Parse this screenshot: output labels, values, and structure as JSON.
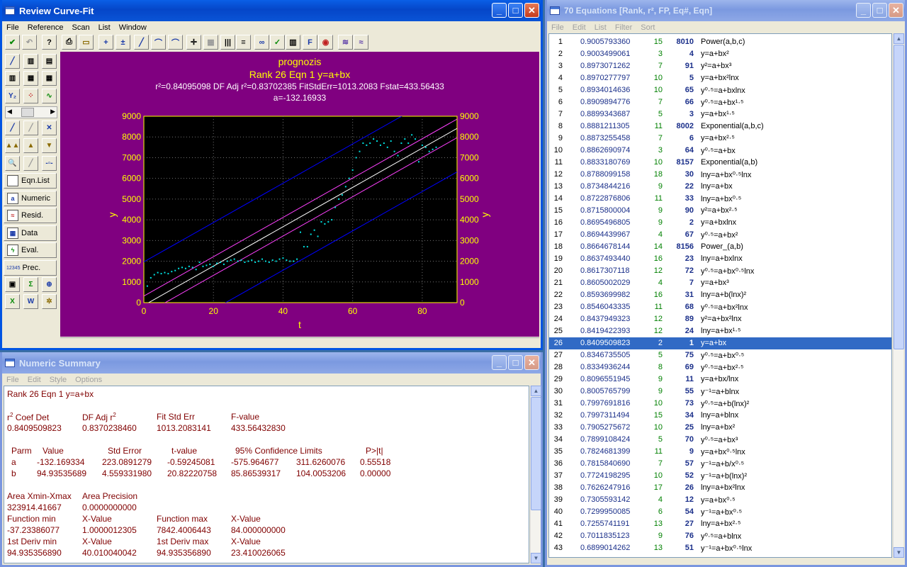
{
  "curvefit": {
    "title": "Review Curve-Fit",
    "menu": [
      "File",
      "Reference",
      "Scan",
      "List",
      "Window"
    ],
    "side_buttons": [
      "Eqn.List",
      "Numeric",
      "Resid.",
      "Data",
      "Eval.",
      "Prec."
    ],
    "prec_icon_text": "12345"
  },
  "chart_data": {
    "type": "scatter",
    "title": "prognozis",
    "subtitle": "Rank 26  Eqn 1  y=a+bx",
    "stats_line": "r²=0.84095098  DF Adj r²=0.83702385  FitStdErr=1013.2083  Fstat=433.56433",
    "param_line": "a=-132.16933",
    "xlabel": "t",
    "ylabel": "y",
    "xlim": [
      0,
      90
    ],
    "ylim": [
      0,
      9000
    ],
    "xticks": [
      "0",
      "20",
      "40",
      "60",
      "80"
    ],
    "yticks": [
      "0",
      "1000",
      "2000",
      "3000",
      "4000",
      "5000",
      "6000",
      "7000",
      "8000",
      "9000"
    ],
    "grid": true,
    "fit": {
      "a": -132.169334,
      "b": 94.93535689
    },
    "colors": {
      "background": "#800080",
      "plot": "#000000",
      "points": "#00e0e0",
      "fit": "#ffffff",
      "confidence": "#ff40ff",
      "prediction": "#0000ff",
      "text": "#ffff00"
    },
    "points": [
      [
        1,
        800
      ],
      [
        2,
        1200
      ],
      [
        3,
        1350
      ],
      [
        4,
        1450
      ],
      [
        5,
        1400
      ],
      [
        6,
        1450
      ],
      [
        7,
        1400
      ],
      [
        8,
        1500
      ],
      [
        9,
        1550
      ],
      [
        10,
        1650
      ],
      [
        11,
        1700
      ],
      [
        12,
        1650
      ],
      [
        13,
        1750
      ],
      [
        14,
        1700
      ],
      [
        15,
        1600
      ],
      [
        16,
        1950
      ],
      [
        17,
        1750
      ],
      [
        18,
        1800
      ],
      [
        19,
        1850
      ],
      [
        20,
        1750
      ],
      [
        21,
        1900
      ],
      [
        22,
        1950
      ],
      [
        23,
        1850
      ],
      [
        24,
        2000
      ],
      [
        25,
        2050
      ],
      [
        26,
        2100
      ],
      [
        27,
        2000
      ],
      [
        28,
        2050
      ],
      [
        29,
        1950
      ],
      [
        30,
        2000
      ],
      [
        31,
        2050
      ],
      [
        32,
        1950
      ],
      [
        33,
        2000
      ],
      [
        34,
        2100
      ],
      [
        35,
        2000
      ],
      [
        36,
        1950
      ],
      [
        37,
        2050
      ],
      [
        38,
        2000
      ],
      [
        39,
        2100
      ],
      [
        40,
        2150
      ],
      [
        41,
        2050
      ],
      [
        42,
        2000
      ],
      [
        43,
        2000
      ],
      [
        44,
        2100
      ],
      [
        45,
        3400
      ],
      [
        46,
        2700
      ],
      [
        47,
        2700
      ],
      [
        48,
        3300
      ],
      [
        49,
        3500
      ],
      [
        50,
        3200
      ],
      [
        51,
        3900
      ],
      [
        52,
        3800
      ],
      [
        53,
        3900
      ],
      [
        54,
        4000
      ],
      [
        55,
        4600
      ],
      [
        56,
        5000
      ],
      [
        57,
        5200
      ],
      [
        58,
        5600
      ],
      [
        59,
        6000
      ],
      [
        60,
        6400
      ],
      [
        61,
        7000
      ],
      [
        62,
        7300
      ],
      [
        63,
        7700
      ],
      [
        64,
        7600
      ],
      [
        65,
        7700
      ],
      [
        66,
        7900
      ],
      [
        67,
        7800
      ],
      [
        68,
        7600
      ],
      [
        69,
        7700
      ],
      [
        70,
        7500
      ],
      [
        71,
        7800
      ],
      [
        72,
        7300
      ],
      [
        73,
        7100
      ],
      [
        74,
        7700
      ],
      [
        75,
        7900
      ],
      [
        76,
        7700
      ],
      [
        77,
        8100
      ],
      [
        78,
        7900
      ],
      [
        79,
        6800
      ],
      [
        80,
        7600
      ],
      [
        81,
        7500
      ],
      [
        82,
        7300
      ],
      [
        83,
        7400
      ],
      [
        84,
        7500
      ]
    ]
  },
  "numeric": {
    "title": "Numeric Summary",
    "menu": [
      "File",
      "Edit",
      "Style",
      "Options"
    ],
    "header": "Rank 26   Eqn 1   y=a+bx",
    "h_r2": "Coef Det",
    "h_dfadj": "DF Adj r",
    "h_fitstd": "Fit Std Err",
    "h_fval": "F-value",
    "r2": "0.8409509823",
    "dfadj": "0.8370238460",
    "fitstd": "1013.2083141",
    "fval": "433.56432830",
    "parm_headers": [
      "Parm",
      "Value",
      "Std Error",
      "t-value",
      "95% Confidence Limits",
      "P>|t|"
    ],
    "parm_rows": [
      [
        "a",
        "-132.169334",
        "223.0891279",
        "-0.59245081",
        "-575.964677",
        "311.6260076",
        "0.55518"
      ],
      [
        "b",
        "94.93535689",
        "4.559331980",
        "20.82220758",
        "85.86539317",
        "104.0053206",
        "0.00000"
      ]
    ],
    "area_label": "Area Xmin-Xmax",
    "area_prec_label": "Area Precision",
    "area": "323914.41667",
    "area_prec": "0.0000000000",
    "fmin_label": "Function min",
    "xv1_label": "X-Value",
    "fmax_label": "Function max",
    "xv2_label": "X-Value",
    "fmin": "-37.23386077",
    "fmin_x": "1.0000012305",
    "fmax": "7842.4006443",
    "fmax_x": "84.000000000",
    "d1min_label": "1st Deriv min",
    "xv3_label": "X-Value",
    "d1max_label": "1st Deriv max",
    "xv4_label": "X-Value",
    "d1min": "94.935356890",
    "d1min_x": "40.010040042",
    "d1max": "94.935356890",
    "d1max_x": "23.410026065"
  },
  "equations": {
    "title": "70 Equations  [Rank, r², FP, Eq#, Eqn]",
    "menu": [
      "File",
      "Edit",
      "List",
      "Filter",
      "Sort"
    ],
    "selected_rank": "26",
    "rows": [
      [
        "1",
        "0.9005793360",
        "15",
        "8010",
        "Power(a,b,c)"
      ],
      [
        "2",
        "0.9003499061",
        "3",
        "4",
        "y=a+bx²"
      ],
      [
        "3",
        "0.8973071262",
        "7",
        "91",
        "y²=a+bx³"
      ],
      [
        "4",
        "0.8970277797",
        "10",
        "5",
        "y=a+bx²lnx"
      ],
      [
        "5",
        "0.8934014636",
        "10",
        "65",
        "y⁰·⁵=a+bxlnx"
      ],
      [
        "6",
        "0.8909894776",
        "7",
        "66",
        "y⁰·⁵=a+bx¹·⁵"
      ],
      [
        "7",
        "0.8899343687",
        "5",
        "3",
        "y=a+bx¹·⁵"
      ],
      [
        "8",
        "0.8881211305",
        "11",
        "8002",
        "Exponential(a,b,c)"
      ],
      [
        "9",
        "0.8873255458",
        "7",
        "6",
        "y=a+bx²·⁵"
      ],
      [
        "10",
        "0.8862690974",
        "3",
        "64",
        "y⁰·⁵=a+bx"
      ],
      [
        "11",
        "0.8833180769",
        "10",
        "8157",
        "Exponential(a,b)"
      ],
      [
        "12",
        "0.8788099158",
        "18",
        "30",
        "lny=a+bx⁰·⁵lnx"
      ],
      [
        "13",
        "0.8734844216",
        "9",
        "22",
        "lny=a+bx"
      ],
      [
        "14",
        "0.8722876806",
        "11",
        "33",
        "lny=a+bx⁰·⁵"
      ],
      [
        "15",
        "0.8715800004",
        "9",
        "90",
        "y²=a+bx²·⁵"
      ],
      [
        "16",
        "0.8695496805",
        "9",
        "2",
        "y=a+bxlnx"
      ],
      [
        "17",
        "0.8694439967",
        "4",
        "67",
        "y⁰·⁵=a+bx²"
      ],
      [
        "18",
        "0.8664678144",
        "14",
        "8156",
        "Power_(a,b)"
      ],
      [
        "19",
        "0.8637493440",
        "16",
        "23",
        "lny=a+bxlnx"
      ],
      [
        "20",
        "0.8617307118",
        "12",
        "72",
        "y⁰·⁵=a+bx⁰·⁵lnx"
      ],
      [
        "21",
        "0.8605002029",
        "4",
        "7",
        "y=a+bx³"
      ],
      [
        "22",
        "0.8593699982",
        "16",
        "31",
        "lny=a+b(lnx)²"
      ],
      [
        "23",
        "0.8546043335",
        "11",
        "68",
        "y⁰·⁵=a+bx²lnx"
      ],
      [
        "24",
        "0.8437949323",
        "12",
        "89",
        "y²=a+bx²lnx"
      ],
      [
        "25",
        "0.8419422393",
        "12",
        "24",
        "lny=a+bx¹·⁵"
      ],
      [
        "26",
        "0.8409509823",
        "2",
        "1",
        "y=a+bx"
      ],
      [
        "27",
        "0.8346735505",
        "5",
        "75",
        "y⁰·⁵=a+bx⁰·⁵"
      ],
      [
        "28",
        "0.8334936244",
        "8",
        "69",
        "y⁰·⁵=a+bx²·⁵"
      ],
      [
        "29",
        "0.8096551945",
        "9",
        "11",
        "y=a+bx/lnx"
      ],
      [
        "30",
        "0.8005765799",
        "9",
        "55",
        "y⁻¹=a+blnx"
      ],
      [
        "31",
        "0.7997691816",
        "10",
        "73",
        "y⁰·⁵=a+b(lnx)²"
      ],
      [
        "32",
        "0.7997311494",
        "15",
        "34",
        "lny=a+blnx"
      ],
      [
        "33",
        "0.7905275672",
        "10",
        "25",
        "lny=a+bx²"
      ],
      [
        "34",
        "0.7899108424",
        "5",
        "70",
        "y⁰·⁵=a+bx³"
      ],
      [
        "35",
        "0.7824681399",
        "11",
        "9",
        "y=a+bx⁰·⁵lnx"
      ],
      [
        "36",
        "0.7815840690",
        "7",
        "57",
        "y⁻¹=a+b/x⁰·⁵"
      ],
      [
        "37",
        "0.7724198295",
        "10",
        "52",
        "y⁻¹=a+b(lnx)²"
      ],
      [
        "38",
        "0.7626247916",
        "17",
        "26",
        "lny=a+bx²lnx"
      ],
      [
        "39",
        "0.7305593142",
        "4",
        "12",
        "y=a+bx⁰·⁵"
      ],
      [
        "40",
        "0.7299950085",
        "6",
        "54",
        "y⁻¹=a+bx⁰·⁵"
      ],
      [
        "41",
        "0.7255741191",
        "13",
        "27",
        "lny=a+bx²·⁵"
      ],
      [
        "42",
        "0.7011835123",
        "9",
        "76",
        "y⁰·⁵=a+blnx"
      ],
      [
        "43",
        "0.6899014262",
        "13",
        "51",
        "y⁻¹=a+bx⁰·⁵lnx"
      ]
    ]
  }
}
